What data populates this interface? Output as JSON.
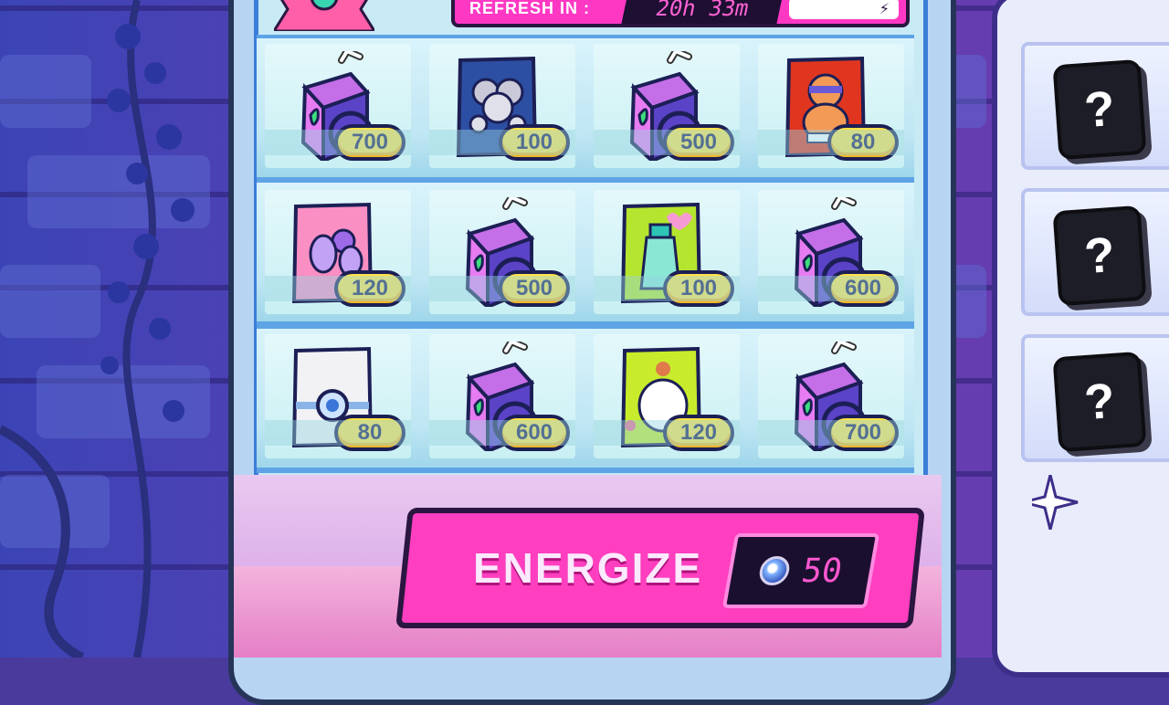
{
  "header": {
    "refresh_label": "REFRESH IN :",
    "refresh_time": "20h 33m"
  },
  "shop": {
    "rows": [
      [
        {
          "item": "juice-box",
          "price": "700"
        },
        {
          "item": "mouse-snack-bag",
          "price": "100"
        },
        {
          "item": "juice-box",
          "price": "500"
        },
        {
          "item": "bear-snack-bag",
          "price": "80"
        }
      ],
      [
        {
          "item": "pink-fairy-snack-bag",
          "price": "120"
        },
        {
          "item": "juice-box",
          "price": "500"
        },
        {
          "item": "spray-bottle-snack-bag",
          "price": "100"
        },
        {
          "item": "juice-box",
          "price": "600"
        }
      ],
      [
        {
          "item": "white-gem-snack-bag",
          "price": "80"
        },
        {
          "item": "juice-box",
          "price": "600"
        },
        {
          "item": "cat-flower-snack-bag",
          "price": "120"
        },
        {
          "item": "juice-box",
          "price": "700"
        }
      ]
    ]
  },
  "energize": {
    "label": "ENERGIZE",
    "cost": "50",
    "currency_icon": "gem-coin-icon"
  },
  "side_panel": {
    "slots": [
      "?",
      "?",
      "?"
    ]
  },
  "colors": {
    "accent_pink": "#ff3fbf",
    "price_yellow": "#ffe24a",
    "dark_navy": "#1c1f55"
  }
}
